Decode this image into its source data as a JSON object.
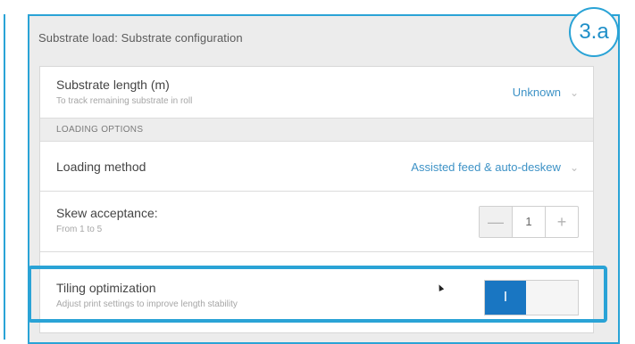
{
  "badge": "3.a",
  "window": {
    "title": "Substrate load: Substrate configuration"
  },
  "substrate_length": {
    "label": "Substrate length (m)",
    "sub": "To track remaining substrate in roll",
    "value": "Unknown"
  },
  "section": {
    "title": "LOADING OPTIONS"
  },
  "loading_method": {
    "label": "Loading method",
    "value": "Assisted feed & auto-deskew"
  },
  "skew": {
    "label": "Skew acceptance:",
    "sub": "From 1 to 5",
    "value": "1",
    "minus": "—",
    "plus": "+"
  },
  "tiling": {
    "label": "Tiling optimization",
    "sub": "Adjust print settings to improve length stability",
    "toggle_on_label": "I",
    "enabled": true
  },
  "icons": {
    "chevron": "chevron-down-icon",
    "cursor": "mouse-pointer-icon"
  },
  "colors": {
    "accent": "#2aa3d6",
    "toggle_on": "#1976c2",
    "value_text": "#3d92c6"
  }
}
